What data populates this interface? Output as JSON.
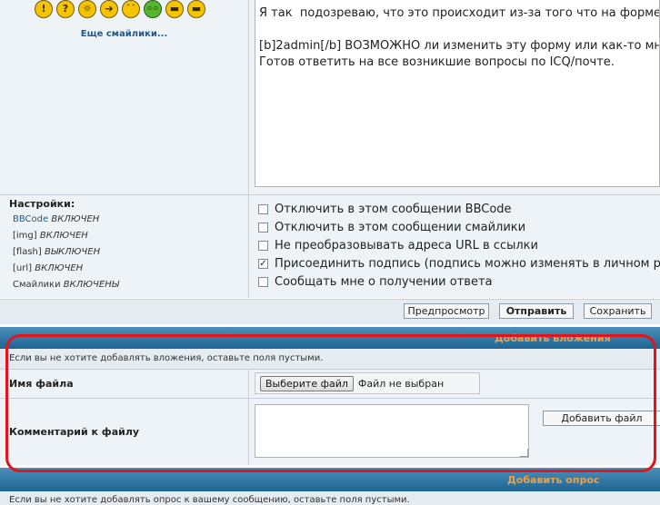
{
  "smileys": {
    "icons": [
      "exclamation-smiley-icon",
      "question-smiley-icon",
      "idea-smiley-icon",
      "arrow-smiley-icon",
      "neutral-smiley-icon",
      "green-alien-smiley-icon",
      "cool-smiley-icon",
      "cool-mustache-smiley-icon"
    ],
    "more_link": "Еще смайлики..."
  },
  "message": {
    "line1": "Я так  подозреваю, что это происходит из-за того что на форме",
    "line2": "[b]2admin[/b] ВОЗМОЖНО ли изменить эту форму или как-то мн",
    "line3": "Готов ответить на все возникшие вопросы по ICQ/почте."
  },
  "settings": {
    "title": "Настройки:",
    "bbcode_name": "BBCode",
    "bbcode_state": "ВКЛЮЧЕН",
    "img_name": "[img]",
    "img_state": "ВКЛЮЧЕН",
    "flash_name": "[flash]",
    "flash_state": "ВЫКЛЮЧЕН",
    "url_name": "[url]",
    "url_state": "ВКЛЮЧЕН",
    "smilies_name": "Смайлики",
    "smilies_state": "ВКЛЮЧЕНЫ"
  },
  "options": [
    {
      "label": "Отключить в этом сообщении BBCode",
      "checked": false
    },
    {
      "label": "Отключить в этом сообщении смайлики",
      "checked": false
    },
    {
      "label": "Не преобразовывать адреса URL в ссылки",
      "checked": false
    },
    {
      "label": "Присоединить подпись (подпись можно изменять в личном разде",
      "checked": true
    },
    {
      "label": "Сообщать мне о получении ответа",
      "checked": false
    }
  ],
  "buttons": {
    "preview": "Предпросмотр",
    "submit": "Отправить",
    "save": "Сохранить"
  },
  "attachments": {
    "header": "Добавить вложения",
    "note": "Если вы не хотите добавлять вложения, оставьте поля пустыми.",
    "filename_label": "Имя файла",
    "choose_file": "Выберите файл",
    "no_file": "Файл не выбран",
    "comment_label": "Комментарий к файлу",
    "add_file": "Добавить файл"
  },
  "poll": {
    "header": "Добавить опрос",
    "note": "Если вы не хотите добавлять опрос к вашему сообщению, оставьте поля пустыми."
  },
  "colors": {
    "bar_blue": "#2f77a4",
    "bar_text": "#e8a14c",
    "highlight_red": "#e2141c",
    "panel_bg": "#eef3f8"
  }
}
